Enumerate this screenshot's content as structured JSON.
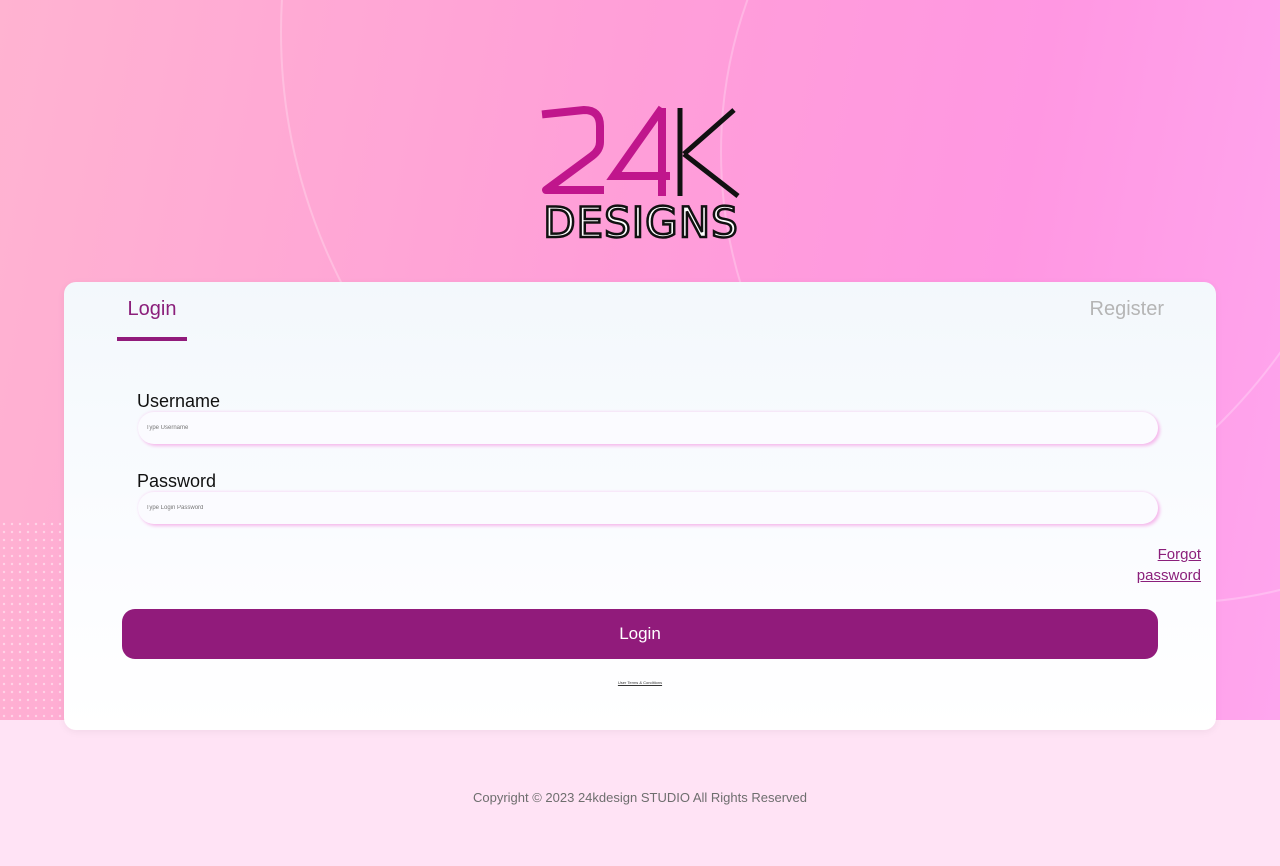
{
  "brand": {
    "logo_text_top": "24K",
    "logo_text_bottom": "DESIGNS",
    "logo_accent_color": "#c0168c"
  },
  "tabs": {
    "login_label": "Login",
    "register_label": "Register",
    "active": "Login"
  },
  "form": {
    "username_label": "Username",
    "username_placeholder": "Type Username",
    "username_value": "",
    "password_label": "Password",
    "password_placeholder": "Type Login Password",
    "password_value": "",
    "forgot_line1": "Forgot",
    "forgot_line2": "password",
    "submit_label": "Login",
    "terms_label": "User Terms & Conditions"
  },
  "footer": {
    "copyright": "Copyright © 2023 24kdesign STUDIO All Rights Reserved"
  },
  "colors": {
    "accent": "#911b7b",
    "hero_gradient_start": "#ffb3d1",
    "hero_gradient_end": "#ffa6ee",
    "footer_bg": "#ffe3f5"
  }
}
